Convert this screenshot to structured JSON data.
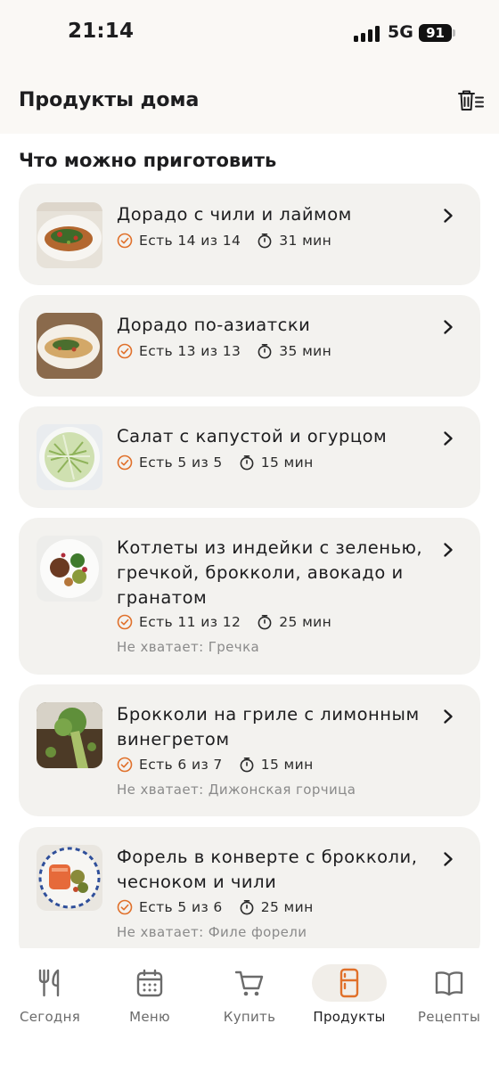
{
  "status_bar": {
    "time": "21:14",
    "network": "5G",
    "battery": "91"
  },
  "header": {
    "title": "Продукты дома"
  },
  "section": {
    "title": "Что можно приготовить"
  },
  "recipes": [
    {
      "title": "Дорадо с чили и лаймом",
      "have": "Есть 14 из 14",
      "time": "31 мин",
      "missing": ""
    },
    {
      "title": "Дорадо по-азиатски",
      "have": "Есть 13 из 13",
      "time": "35 мин",
      "missing": ""
    },
    {
      "title": "Салат с капустой и огурцом",
      "have": "Есть 5 из 5",
      "time": "15 мин",
      "missing": ""
    },
    {
      "title": "Котлеты из индейки с зеленью, гречкой, брокколи, авокадо и гранатом",
      "have": "Есть 11 из 12",
      "time": "25 мин",
      "missing": "Не хватает: Гречка"
    },
    {
      "title": "Брокколи на гриле с лимонным винегретом",
      "have": "Есть 6 из 7",
      "time": "15 мин",
      "missing": "Не хватает: Дижонская горчица"
    },
    {
      "title": "Форель в конверте с брокколи, чесноком и чили",
      "have": "Есть 5 из 6",
      "time": "25 мин",
      "missing": "Не хватает: Филе форели"
    }
  ],
  "tabbar": {
    "tabs": [
      {
        "label": "Сегодня",
        "icon": "fork-knife-icon"
      },
      {
        "label": "Меню",
        "icon": "calendar-icon"
      },
      {
        "label": "Купить",
        "icon": "cart-icon"
      },
      {
        "label": "Продукты",
        "icon": "fridge-icon",
        "active": true
      },
      {
        "label": "Рецепты",
        "icon": "book-icon"
      }
    ]
  },
  "colors": {
    "accent": "#e0702a",
    "card_bg": "#f3f2ef",
    "header_bg": "#faf8f5"
  }
}
